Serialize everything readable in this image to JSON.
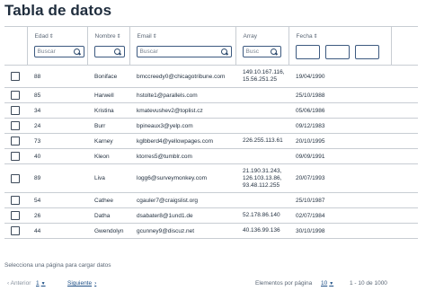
{
  "title": "Tabla de datos",
  "columns": {
    "edad": "Edad",
    "nombre": "Nombre",
    "email": "Email",
    "array": "Array",
    "fecha": "Fecha"
  },
  "filters": {
    "edad_placeholder": "Buscar",
    "nombre_placeholder": "",
    "email_placeholder": "Buscar",
    "array_placeholder": "Busc"
  },
  "rows": [
    {
      "edad": "88",
      "nombre": "Boniface",
      "email": "bmccreedy0@chicagotribune.com",
      "array": "149.10.167.116,\n15.56.251.25",
      "fecha": "19/04/1990"
    },
    {
      "edad": "85",
      "nombre": "Harwell",
      "email": "hstolte1@parallels.com",
      "array": "",
      "fecha": "25/10/1988"
    },
    {
      "edad": "34",
      "nombre": "Kristina",
      "email": "kmatevushev2@toplist.cz",
      "array": "",
      "fecha": "05/06/1986"
    },
    {
      "edad": "24",
      "nombre": "Burr",
      "email": "bpineaux3@yelp.com",
      "array": "",
      "fecha": "09/12/1983"
    },
    {
      "edad": "73",
      "nombre": "Karney",
      "email": "kglbberd4@yellowpages.com",
      "array": "226.255.113.61",
      "fecha": "20/10/1995"
    },
    {
      "edad": "40",
      "nombre": "Kleon",
      "email": "ktorres5@tumblr.com",
      "array": "",
      "fecha": "09/09/1991"
    },
    {
      "edad": "89",
      "nombre": "Liva",
      "email": "logg6@surveymonkey.com",
      "array": "21.190.31.243,\n126.103.13.86,\n93.48.112.255",
      "fecha": "20/07/1993"
    },
    {
      "edad": "54",
      "nombre": "Cathee",
      "email": "cgauler7@craigslist.org",
      "array": "",
      "fecha": "25/10/1987"
    },
    {
      "edad": "26",
      "nombre": "Datha",
      "email": "dsabater8@1und1.de",
      "array": "52.178.86.140",
      "fecha": "02/07/1984"
    },
    {
      "edad": "44",
      "nombre": "Gwendolyn",
      "email": "gcunney9@discuz.net",
      "array": "40.136.99.136",
      "fecha": "30/10/1998"
    }
  ],
  "status_text": "Selecciona una página para cargar datos",
  "pagination": {
    "prev_label": "Anterior",
    "current_page": "1",
    "next_label": "Siguiente",
    "per_page_label": "Elementos por página",
    "per_page_value": "10",
    "range_text": "1 - 10 de 1000"
  }
}
